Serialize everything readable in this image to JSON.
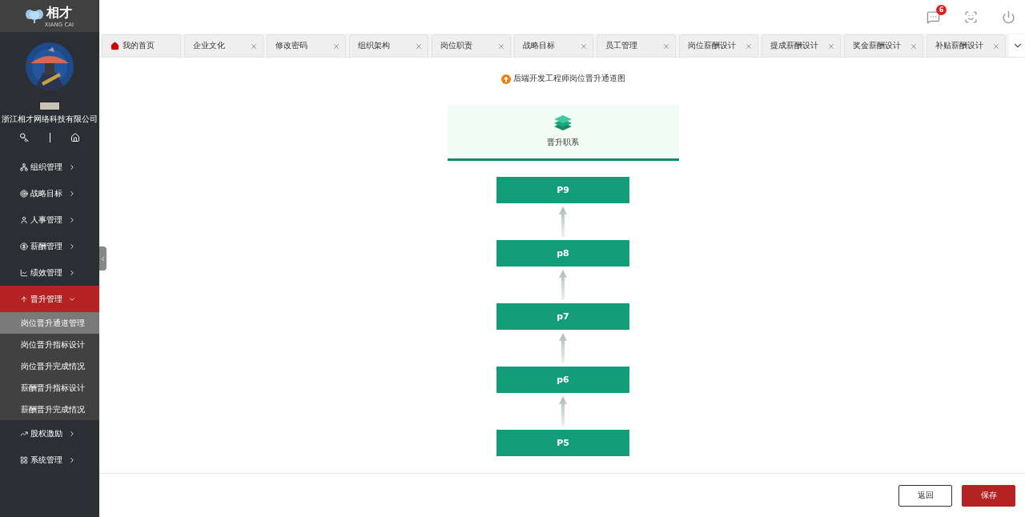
{
  "sidebar": {
    "logo": {
      "text": "相才",
      "subtitle": "XIANG CAI"
    },
    "company": "浙江相才网络科技有限公司",
    "menu": [
      {
        "kind": "org",
        "label": "组织管理",
        "expanded": false,
        "selected": false
      },
      {
        "kind": "target",
        "label": "战略目标",
        "expanded": false,
        "selected": false
      },
      {
        "kind": "user",
        "label": "人事管理",
        "expanded": false,
        "selected": false
      },
      {
        "kind": "money",
        "label": "薪酬管理",
        "expanded": false,
        "selected": false
      },
      {
        "kind": "chart",
        "label": "绩效管理",
        "expanded": false,
        "selected": false
      },
      {
        "kind": "up",
        "label": "晋升管理",
        "expanded": true,
        "selected": true,
        "children": [
          {
            "label": "岗位晋升通道管理",
            "selected": true
          },
          {
            "label": "岗位晋升指标设计",
            "selected": false
          },
          {
            "label": "岗位晋升完成情况",
            "selected": false
          },
          {
            "label": "薪酬晋升指标设计",
            "selected": false
          },
          {
            "label": "薪酬晋升完成情况",
            "selected": false
          }
        ]
      },
      {
        "kind": "trend",
        "label": "股权激励",
        "expanded": false,
        "selected": false
      },
      {
        "kind": "grid",
        "label": "系统管理",
        "expanded": false,
        "selected": false
      }
    ]
  },
  "header": {
    "message_badge": "6"
  },
  "tabs": [
    {
      "label": "我的首页",
      "home": true,
      "selected": false
    },
    {
      "label": "企业文化",
      "home": false,
      "selected": false
    },
    {
      "label": "修改密码",
      "home": false,
      "selected": false
    },
    {
      "label": "组织架构",
      "home": false,
      "selected": false
    },
    {
      "label": "岗位职责",
      "home": false,
      "selected": false
    },
    {
      "label": "战略目标",
      "home": false,
      "selected": false
    },
    {
      "label": "员工管理",
      "home": false,
      "selected": false
    },
    {
      "label": "岗位薪酬设计",
      "home": false,
      "selected": false
    },
    {
      "label": "提成薪酬设计",
      "home": false,
      "selected": false
    },
    {
      "label": "奖金薪酬设计",
      "home": false,
      "selected": false
    },
    {
      "label": "补贴薪酬设计",
      "home": false,
      "selected": false
    }
  ],
  "page": {
    "title": "后端开发工程师岗位晋升通道图",
    "system_label": "晋升职系",
    "levels": [
      "P9",
      "p8",
      "p7",
      "p6",
      "P5"
    ]
  },
  "buttons": {
    "back": "返回",
    "save": "保存"
  }
}
